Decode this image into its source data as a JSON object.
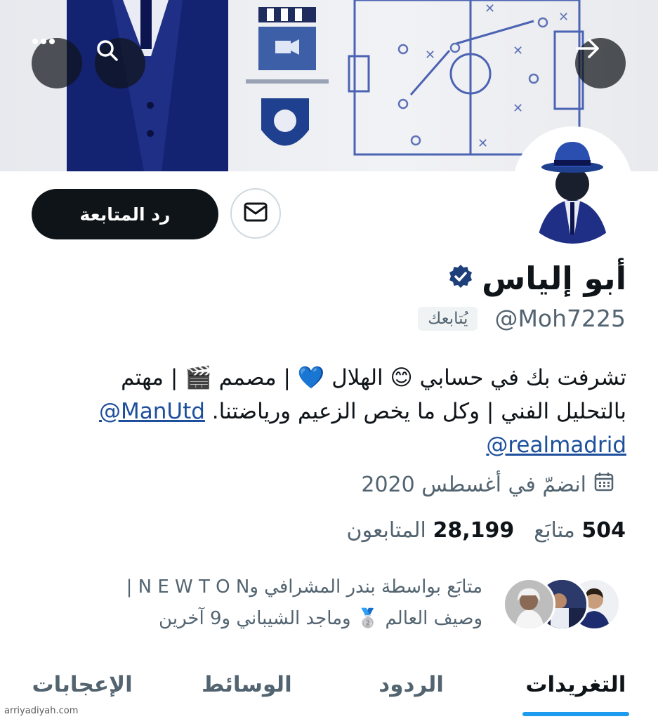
{
  "profile": {
    "name": "أبو إلياس",
    "handle": "@Moh7225",
    "follows_you": "يُتابعك",
    "bio_lines": [
      "تشرفت بك في حسابي 😊 الهلال 💙 | مصمم 🎬 | مهتم",
      "بالتحليل الفني | وكل ما يخص الزعيم ورياضتنا."
    ],
    "mentions": [
      "@ManUtd",
      "@realmadrid"
    ],
    "joined": "انضمّ في أغسطس 2020",
    "following_count": "504",
    "following_label": "متابَع",
    "followers_count": "28,199",
    "followers_label": "المتابعون",
    "followed_by_lines": [
      "متابَع بواسطة بندر المشرافي وN E W T O N |",
      "وصيف العالم 🥈 وماجد الشيباني و9 آخرين"
    ]
  },
  "actions": {
    "follow_back_label": "رد المتابعة",
    "message_icon": "envelope-icon",
    "more_icon": "more-dots-icon",
    "search_icon": "search-icon",
    "back_icon": "arrow-right-icon"
  },
  "tabs": [
    {
      "label": "التغريدات",
      "active": true
    },
    {
      "label": "الردود",
      "active": false
    },
    {
      "label": "الوسائط",
      "active": false
    },
    {
      "label": "الإعجابات",
      "active": false
    }
  ],
  "colors": {
    "primary_text": "#0f1419",
    "secondary_text": "#536471",
    "accent": "#1d9bf0",
    "verified": "#1e3f7a",
    "mention": "#1d4f9c"
  },
  "watermark": "arriyadiyah.com"
}
